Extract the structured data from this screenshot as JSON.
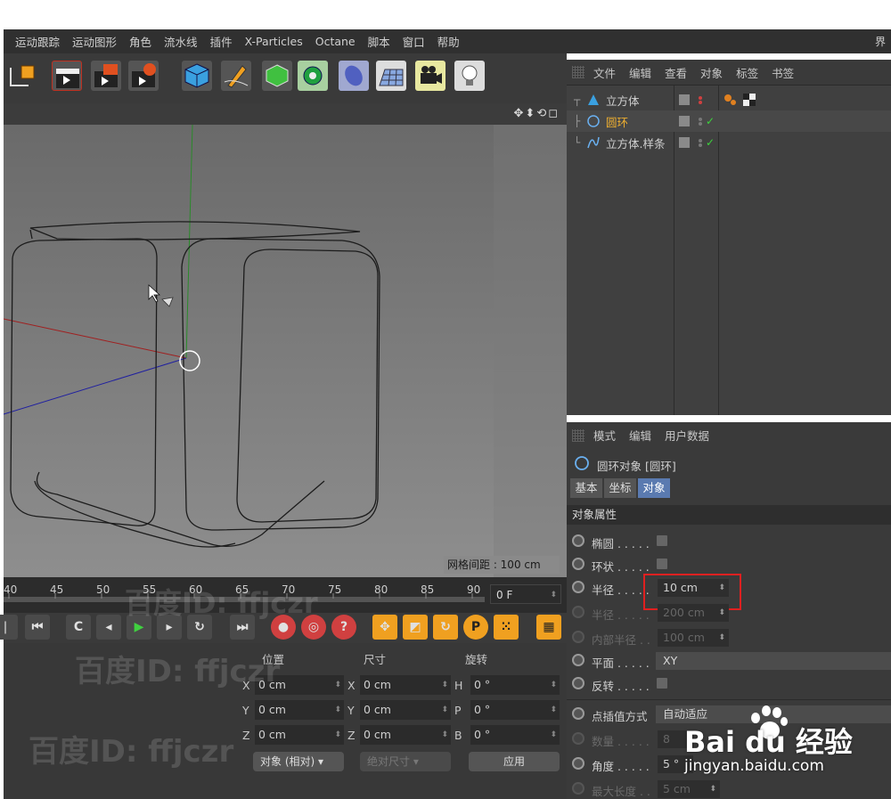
{
  "menubar": {
    "items": [
      "运动跟踪",
      "运动图形",
      "角色",
      "流水线",
      "插件",
      "X-Particles",
      "Octane",
      "脚本",
      "窗口",
      "帮助"
    ],
    "right": "界"
  },
  "object_manager": {
    "menu": [
      "文件",
      "编辑",
      "查看",
      "对象",
      "标签",
      "书签"
    ],
    "objects": [
      {
        "name": "立方体",
        "icon": "cube-object-icon",
        "color": "#d0d0d0"
      },
      {
        "name": "圆环",
        "icon": "circle-spline-icon",
        "color": "#f0b030"
      },
      {
        "name": "立方体.样条",
        "icon": "spline-icon",
        "color": "#d0d0d0"
      }
    ]
  },
  "attribute_manager": {
    "menu": [
      "模式",
      "编辑",
      "用户数据"
    ],
    "object_title": "圆环对象 [圆环]",
    "tabs": [
      "基本",
      "坐标",
      "对象"
    ],
    "section": "对象属性",
    "props": {
      "ellipse": "椭圆 . . . . .",
      "ring": "环状 . . . . .",
      "radius": "半径 . . . . .",
      "radius_value": "10 cm",
      "radius2": "半径 . . . . .",
      "radius2_value": "200 cm",
      "inner_radius": "内部半径 . .",
      "inner_radius_value": "100 cm",
      "plane": "平面 . . . . .",
      "plane_value": "XY",
      "reverse": "反转 . . . . .",
      "interp": "点插值方式",
      "interp_value": "自动适应",
      "count": "数量 . . . . .",
      "count_value": "8",
      "angle": "角度 . . . . .",
      "angle_value": "5 °",
      "maxlen": "最大长度 . .",
      "maxlen_value": "5 cm"
    }
  },
  "viewport": {
    "grid_spacing": "网格间距 : 100 cm"
  },
  "timeline": {
    "ticks": [
      "40",
      "45",
      "50",
      "55",
      "60",
      "65",
      "70",
      "75",
      "80",
      "85",
      "90"
    ],
    "frame": "0 F"
  },
  "coords": {
    "headers": {
      "position": "位置",
      "size": "尺寸",
      "rotation": "旋转"
    },
    "pos": [
      {
        "axis": "X",
        "value": "0 cm"
      },
      {
        "axis": "Y",
        "value": "0 cm"
      },
      {
        "axis": "Z",
        "value": "0 cm"
      }
    ],
    "size": [
      {
        "axis": "X",
        "value": "0 cm"
      },
      {
        "axis": "Y",
        "value": "0 cm"
      },
      {
        "axis": "Z",
        "value": "0 cm"
      }
    ],
    "rot": [
      {
        "axis": "H",
        "value": "0 °"
      },
      {
        "axis": "P",
        "value": "0 °"
      },
      {
        "axis": "B",
        "value": "0 °"
      }
    ],
    "mode": "对象 (相对)",
    "size_mode": "绝对尺寸",
    "apply": "应用"
  },
  "watermarks": {
    "baidu_id": "百度ID: ffjczr",
    "baidu_logo": "Bai du 经验",
    "baidu_url": "jingyan.baidu.com"
  },
  "colors": {
    "highlight_box": "#e02020",
    "active_tab": "#5a7ab0",
    "accent_yellow": "#f0b030"
  }
}
